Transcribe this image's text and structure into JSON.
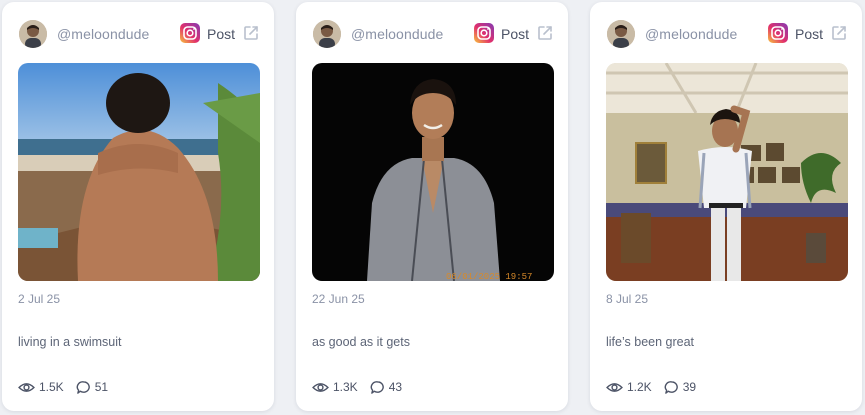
{
  "posts": [
    {
      "username": "@meloondude",
      "platform": "instagram-icon",
      "post_label": "Post",
      "date": "2 Jul 25",
      "caption": "living in a swimsuit",
      "views": "1.5K",
      "comments": "51"
    },
    {
      "username": "@meloondude",
      "platform": "instagram-icon",
      "post_label": "Post",
      "date": "22 Jun 25",
      "caption": "as good as it gets",
      "views": "1.3K",
      "comments": "43",
      "photo_timestamp": "06/01/2025 19:57"
    },
    {
      "username": "@meloondude",
      "platform": "instagram-icon",
      "post_label": "Post",
      "date": "8 Jul 25",
      "caption": "life’s been great",
      "views": "1.2K",
      "comments": "39"
    }
  ],
  "colors": {
    "page_bg": "#eef0f4",
    "card_bg": "#ffffff",
    "muted_text": "#8a92a6",
    "body_text": "#4c5366"
  }
}
